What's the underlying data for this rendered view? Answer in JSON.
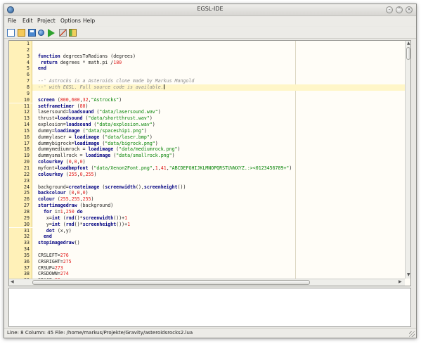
{
  "window": {
    "title": "EGSL-IDE",
    "controls": [
      "minimize-icon",
      "maximize-icon",
      "close-icon"
    ]
  },
  "menu": [
    "File",
    "Edit",
    "Project",
    "Options",
    "Help"
  ],
  "toolbar": [
    {
      "name": "new-file-icon"
    },
    {
      "name": "open-folder-icon"
    },
    {
      "name": "save-icon"
    },
    {
      "name": "compile-icon"
    },
    {
      "name": "run-icon"
    },
    {
      "name": "tools-icon"
    },
    {
      "name": "help-book-icon"
    }
  ],
  "editor": {
    "current_line": 8,
    "lines": [
      [],
      [],
      [
        [
          "function",
          "kw"
        ],
        [
          " degreesToRadians (degrees)",
          ""
        ]
      ],
      [
        [
          " ",
          ""
        ],
        [
          "return",
          "kw"
        ],
        [
          " degrees * math.pi /",
          ""
        ],
        [
          "180",
          "num"
        ]
      ],
      [
        [
          "end",
          "kw"
        ]
      ],
      [],
      [
        [
          "--' Astrocks is a Asteroids clone made by Markus Mangold",
          "com"
        ]
      ],
      [
        [
          "--' with EGSL. Full source code is available.",
          "com"
        ]
      ],
      [],
      [
        [
          "screen",
          "kw"
        ],
        [
          " (",
          ""
        ],
        [
          "800",
          "num"
        ],
        [
          ",",
          ""
        ],
        [
          "600",
          "num"
        ],
        [
          ",",
          ""
        ],
        [
          "32",
          "num"
        ],
        [
          ",",
          ""
        ],
        [
          "\"Astrocks\"",
          "str"
        ],
        [
          ")",
          ""
        ]
      ],
      [
        [
          "setframetimer",
          "kw"
        ],
        [
          " (",
          ""
        ],
        [
          "80",
          "num"
        ],
        [
          ")",
          ""
        ]
      ],
      [
        [
          "lasersound=",
          ""
        ],
        [
          "loadsound",
          "kw"
        ],
        [
          " (",
          ""
        ],
        [
          "\"data/lasersound.wav\"",
          "str"
        ],
        [
          ")",
          ""
        ]
      ],
      [
        [
          "thrust=",
          ""
        ],
        [
          "loadsound",
          "kw"
        ],
        [
          " (",
          ""
        ],
        [
          "\"data/shortthrust.wav\"",
          "str"
        ],
        [
          ")",
          ""
        ]
      ],
      [
        [
          "explosion=",
          ""
        ],
        [
          "loadsound",
          "kw"
        ],
        [
          " (",
          ""
        ],
        [
          "\"data/explosion.wav\"",
          "str"
        ],
        [
          ")",
          ""
        ]
      ],
      [
        [
          "dummy=",
          ""
        ],
        [
          "loadimage",
          "kw"
        ],
        [
          " (",
          ""
        ],
        [
          "\"data/spaceship1.png\"",
          "str"
        ],
        [
          ")",
          ""
        ]
      ],
      [
        [
          "dummylaser = ",
          ""
        ],
        [
          "loadimage",
          "kw"
        ],
        [
          " (",
          ""
        ],
        [
          "\"data/laser.bmp\"",
          "str"
        ],
        [
          ")",
          ""
        ]
      ],
      [
        [
          "dummybigrock=",
          ""
        ],
        [
          "loadimage",
          "kw"
        ],
        [
          " (",
          ""
        ],
        [
          "\"data/bigrock.png\"",
          "str"
        ],
        [
          ")",
          ""
        ]
      ],
      [
        [
          "dummymediumrock = ",
          ""
        ],
        [
          "loadimage",
          "kw"
        ],
        [
          " (",
          ""
        ],
        [
          "\"data/mediumrock.png\"",
          "str"
        ],
        [
          ")",
          ""
        ]
      ],
      [
        [
          "dummysmallrock = ",
          ""
        ],
        [
          "loadimage",
          "kw"
        ],
        [
          " (",
          ""
        ],
        [
          "\"data/smallrock.png\"",
          "str"
        ],
        [
          ")",
          ""
        ]
      ],
      [
        [
          "colourkey",
          "kw"
        ],
        [
          " (",
          ""
        ],
        [
          "0",
          "num"
        ],
        [
          ",",
          ""
        ],
        [
          "0",
          "num"
        ],
        [
          ",",
          ""
        ],
        [
          "0",
          "num"
        ],
        [
          ")",
          ""
        ]
      ],
      [
        [
          "myfont=",
          ""
        ],
        [
          "loadbmpfont",
          "kw"
        ],
        [
          " (",
          ""
        ],
        [
          "\"data/Xenon2Font.png\"",
          "str"
        ],
        [
          ",",
          ""
        ],
        [
          "1",
          "num"
        ],
        [
          ",",
          ""
        ],
        [
          "41",
          "num"
        ],
        [
          ",",
          ""
        ],
        [
          "\"ABCDEFGHIJKLMNOPQRSTUVWXYZ.:><0123456789+\"",
          "str"
        ],
        [
          ")",
          ""
        ]
      ],
      [
        [
          "colourkey",
          "kw"
        ],
        [
          " (",
          ""
        ],
        [
          "255",
          "num"
        ],
        [
          ",",
          ""
        ],
        [
          "0",
          "num"
        ],
        [
          ",",
          ""
        ],
        [
          "255",
          "num"
        ],
        [
          ")",
          ""
        ]
      ],
      [],
      [
        [
          "background=",
          ""
        ],
        [
          "createimage",
          "kw"
        ],
        [
          " (",
          ""
        ],
        [
          "screenwidth",
          "kw"
        ],
        [
          "(),",
          ""
        ],
        [
          "screenheight",
          "kw"
        ],
        [
          "())",
          ""
        ]
      ],
      [
        [
          "backcolour",
          "kw"
        ],
        [
          " (",
          ""
        ],
        [
          "0",
          "num"
        ],
        [
          ",",
          ""
        ],
        [
          "0",
          "num"
        ],
        [
          ",",
          ""
        ],
        [
          "0",
          "num"
        ],
        [
          ")",
          ""
        ]
      ],
      [
        [
          "colour",
          "kw"
        ],
        [
          " (",
          ""
        ],
        [
          "255",
          "num"
        ],
        [
          ",",
          ""
        ],
        [
          "255",
          "num"
        ],
        [
          ",",
          ""
        ],
        [
          "255",
          "num"
        ],
        [
          ")",
          ""
        ]
      ],
      [
        [
          "startimagedraw",
          "kw"
        ],
        [
          " (background)",
          ""
        ]
      ],
      [
        [
          "  ",
          ""
        ],
        [
          "for",
          "kw"
        ],
        [
          " i=",
          ""
        ],
        [
          "1",
          "num"
        ],
        [
          ",",
          ""
        ],
        [
          "250",
          "num"
        ],
        [
          " ",
          ""
        ],
        [
          "do",
          "kw"
        ]
      ],
      [
        [
          "   x=",
          ""
        ],
        [
          "int",
          "kw"
        ],
        [
          " (",
          ""
        ],
        [
          "rnd",
          "kw"
        ],
        [
          "()*",
          ""
        ],
        [
          "screenwidth",
          "kw"
        ],
        [
          "())+",
          ""
        ],
        [
          "1",
          "num"
        ]
      ],
      [
        [
          "   y=",
          ""
        ],
        [
          "int",
          "kw"
        ],
        [
          " (",
          ""
        ],
        [
          "rnd",
          "kw"
        ],
        [
          "()*",
          ""
        ],
        [
          "screenheight",
          "kw"
        ],
        [
          "())+",
          ""
        ],
        [
          "1",
          "num"
        ]
      ],
      [
        [
          "   ",
          ""
        ],
        [
          "dot",
          "kw"
        ],
        [
          " (x,y)",
          ""
        ]
      ],
      [
        [
          "  ",
          ""
        ],
        [
          "end",
          "kw"
        ]
      ],
      [
        [
          "stopimagedraw",
          "kw"
        ],
        [
          "()",
          ""
        ]
      ],
      [],
      [
        [
          "CRSLEFT=",
          ""
        ],
        [
          "276",
          "num"
        ]
      ],
      [
        [
          "CRSRIGHT=",
          ""
        ],
        [
          "275",
          "num"
        ]
      ],
      [
        [
          "CRSUP=",
          ""
        ],
        [
          "273",
          "num"
        ]
      ],
      [
        [
          "CRSDOWN=",
          ""
        ],
        [
          "274",
          "num"
        ]
      ],
      [
        [
          "SPACE=",
          ""
        ],
        [
          "32",
          "num"
        ]
      ]
    ]
  },
  "status": {
    "text": "Line: 8 Column: 45 File: /home/markus/Projekte/Gravity/asteroidsrocks2.lua"
  }
}
